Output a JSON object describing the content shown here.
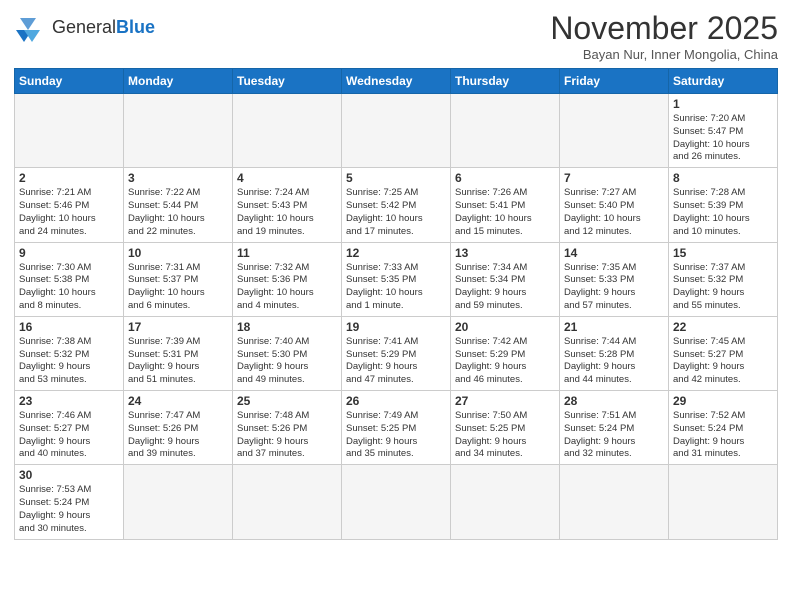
{
  "header": {
    "logo_general": "General",
    "logo_blue": "Blue",
    "month_title": "November 2025",
    "location": "Bayan Nur, Inner Mongolia, China"
  },
  "weekdays": [
    "Sunday",
    "Monday",
    "Tuesday",
    "Wednesday",
    "Thursday",
    "Friday",
    "Saturday"
  ],
  "weeks": [
    [
      {
        "day": "",
        "info": "",
        "empty": true
      },
      {
        "day": "",
        "info": "",
        "empty": true
      },
      {
        "day": "",
        "info": "",
        "empty": true
      },
      {
        "day": "",
        "info": "",
        "empty": true
      },
      {
        "day": "",
        "info": "",
        "empty": true
      },
      {
        "day": "",
        "info": "",
        "empty": true
      },
      {
        "day": "1",
        "info": "Sunrise: 7:20 AM\nSunset: 5:47 PM\nDaylight: 10 hours\nand 26 minutes."
      }
    ],
    [
      {
        "day": "2",
        "info": "Sunrise: 7:21 AM\nSunset: 5:46 PM\nDaylight: 10 hours\nand 24 minutes."
      },
      {
        "day": "3",
        "info": "Sunrise: 7:22 AM\nSunset: 5:44 PM\nDaylight: 10 hours\nand 22 minutes."
      },
      {
        "day": "4",
        "info": "Sunrise: 7:24 AM\nSunset: 5:43 PM\nDaylight: 10 hours\nand 19 minutes."
      },
      {
        "day": "5",
        "info": "Sunrise: 7:25 AM\nSunset: 5:42 PM\nDaylight: 10 hours\nand 17 minutes."
      },
      {
        "day": "6",
        "info": "Sunrise: 7:26 AM\nSunset: 5:41 PM\nDaylight: 10 hours\nand 15 minutes."
      },
      {
        "day": "7",
        "info": "Sunrise: 7:27 AM\nSunset: 5:40 PM\nDaylight: 10 hours\nand 12 minutes."
      },
      {
        "day": "8",
        "info": "Sunrise: 7:28 AM\nSunset: 5:39 PM\nDaylight: 10 hours\nand 10 minutes."
      }
    ],
    [
      {
        "day": "9",
        "info": "Sunrise: 7:30 AM\nSunset: 5:38 PM\nDaylight: 10 hours\nand 8 minutes."
      },
      {
        "day": "10",
        "info": "Sunrise: 7:31 AM\nSunset: 5:37 PM\nDaylight: 10 hours\nand 6 minutes."
      },
      {
        "day": "11",
        "info": "Sunrise: 7:32 AM\nSunset: 5:36 PM\nDaylight: 10 hours\nand 4 minutes."
      },
      {
        "day": "12",
        "info": "Sunrise: 7:33 AM\nSunset: 5:35 PM\nDaylight: 10 hours\nand 1 minute."
      },
      {
        "day": "13",
        "info": "Sunrise: 7:34 AM\nSunset: 5:34 PM\nDaylight: 9 hours\nand 59 minutes."
      },
      {
        "day": "14",
        "info": "Sunrise: 7:35 AM\nSunset: 5:33 PM\nDaylight: 9 hours\nand 57 minutes."
      },
      {
        "day": "15",
        "info": "Sunrise: 7:37 AM\nSunset: 5:32 PM\nDaylight: 9 hours\nand 55 minutes."
      }
    ],
    [
      {
        "day": "16",
        "info": "Sunrise: 7:38 AM\nSunset: 5:32 PM\nDaylight: 9 hours\nand 53 minutes."
      },
      {
        "day": "17",
        "info": "Sunrise: 7:39 AM\nSunset: 5:31 PM\nDaylight: 9 hours\nand 51 minutes."
      },
      {
        "day": "18",
        "info": "Sunrise: 7:40 AM\nSunset: 5:30 PM\nDaylight: 9 hours\nand 49 minutes."
      },
      {
        "day": "19",
        "info": "Sunrise: 7:41 AM\nSunset: 5:29 PM\nDaylight: 9 hours\nand 47 minutes."
      },
      {
        "day": "20",
        "info": "Sunrise: 7:42 AM\nSunset: 5:29 PM\nDaylight: 9 hours\nand 46 minutes."
      },
      {
        "day": "21",
        "info": "Sunrise: 7:44 AM\nSunset: 5:28 PM\nDaylight: 9 hours\nand 44 minutes."
      },
      {
        "day": "22",
        "info": "Sunrise: 7:45 AM\nSunset: 5:27 PM\nDaylight: 9 hours\nand 42 minutes."
      }
    ],
    [
      {
        "day": "23",
        "info": "Sunrise: 7:46 AM\nSunset: 5:27 PM\nDaylight: 9 hours\nand 40 minutes."
      },
      {
        "day": "24",
        "info": "Sunrise: 7:47 AM\nSunset: 5:26 PM\nDaylight: 9 hours\nand 39 minutes."
      },
      {
        "day": "25",
        "info": "Sunrise: 7:48 AM\nSunset: 5:26 PM\nDaylight: 9 hours\nand 37 minutes."
      },
      {
        "day": "26",
        "info": "Sunrise: 7:49 AM\nSunset: 5:25 PM\nDaylight: 9 hours\nand 35 minutes."
      },
      {
        "day": "27",
        "info": "Sunrise: 7:50 AM\nSunset: 5:25 PM\nDaylight: 9 hours\nand 34 minutes."
      },
      {
        "day": "28",
        "info": "Sunrise: 7:51 AM\nSunset: 5:24 PM\nDaylight: 9 hours\nand 32 minutes."
      },
      {
        "day": "29",
        "info": "Sunrise: 7:52 AM\nSunset: 5:24 PM\nDaylight: 9 hours\nand 31 minutes."
      }
    ],
    [
      {
        "day": "30",
        "info": "Sunrise: 7:53 AM\nSunset: 5:24 PM\nDaylight: 9 hours\nand 30 minutes."
      },
      {
        "day": "",
        "info": "",
        "empty": true
      },
      {
        "day": "",
        "info": "",
        "empty": true
      },
      {
        "day": "",
        "info": "",
        "empty": true
      },
      {
        "day": "",
        "info": "",
        "empty": true
      },
      {
        "day": "",
        "info": "",
        "empty": true
      },
      {
        "day": "",
        "info": "",
        "empty": true
      }
    ]
  ]
}
